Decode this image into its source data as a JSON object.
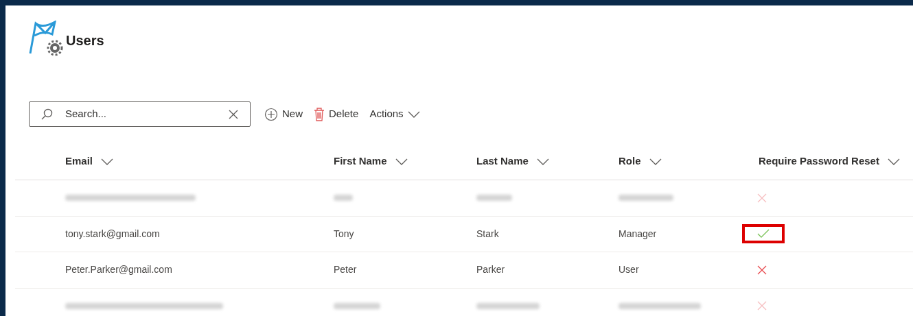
{
  "page": {
    "title": "Users"
  },
  "search": {
    "placeholder": "Search..."
  },
  "toolbar": [
    {
      "kind": "new",
      "label": "New"
    },
    {
      "kind": "delete",
      "label": "Delete"
    },
    {
      "kind": "menu",
      "label": "Actions"
    }
  ],
  "table": {
    "columns": [
      "Email",
      "First Name",
      "Last Name",
      "Role",
      "Require Password Reset"
    ],
    "rows": [
      {
        "kind": "blurred",
        "require_password_reset": false,
        "highlighted": false
      },
      {
        "kind": "plain",
        "cells": [
          "tony.stark@gmail.com",
          "Tony",
          "Stark",
          "Manager"
        ],
        "require_password_reset": true,
        "highlighted": true
      },
      {
        "kind": "plain",
        "cells": [
          "Peter.Parker@gmail.com",
          "Peter",
          "Parker",
          "User"
        ],
        "require_password_reset": false,
        "highlighted": false
      },
      {
        "kind": "blurred",
        "require_password_reset": false,
        "highlighted": false
      }
    ]
  }
}
